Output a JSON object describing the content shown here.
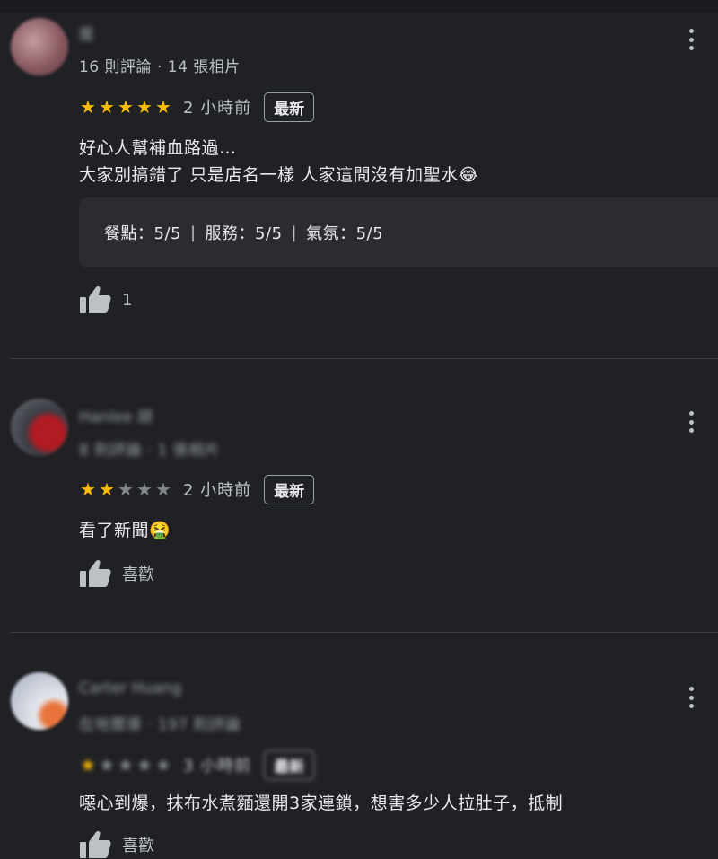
{
  "reviews": [
    {
      "author": "匿",
      "meta": "16 則評論 · 14 張相片",
      "stars": 5,
      "time": "2 小時前",
      "badge": "最新",
      "text_line1": "好心人幫補血路過…",
      "text_line2": "大家別搞錯了 只是店名一樣 人家這間沒有加聖水😂",
      "ratings": {
        "food": "餐點：5/5",
        "service": "服務：5/5",
        "atmosphere": "氣氛：5/5",
        "separator": "|"
      },
      "likes": "1",
      "avatar_colors": [
        "#8a5a62",
        "#c49ca0",
        "#5b3a40"
      ]
    },
    {
      "author": "Hanlee 胡",
      "meta": "8 則評論 · 1 張相片",
      "stars": 2,
      "time": "2 小時前",
      "badge": "最新",
      "text": "看了新聞🤮",
      "like_label": "喜歡",
      "avatar_colors": [
        "#3b3d45",
        "#b11b22",
        "#6e6f75"
      ]
    },
    {
      "author": "Carter Huang",
      "meta": "在地嚮導 · 197 則評論",
      "stars": 1,
      "time": "3 小時前",
      "badge": "最新",
      "text": "噁心到爆，抹布水煮麵還開3家連鎖，想害多少人拉肚子，抵制",
      "like_label": "喜歡",
      "avatar_colors": [
        "#a8b0c0",
        "#e3e6ec",
        "#e8743b"
      ]
    }
  ],
  "star_glyph": "★",
  "colors": {
    "background": "#202124",
    "star_on": "#fbbc04",
    "star_off": "#80868b",
    "divider": "#3c4043",
    "box": "#2b2c30"
  }
}
